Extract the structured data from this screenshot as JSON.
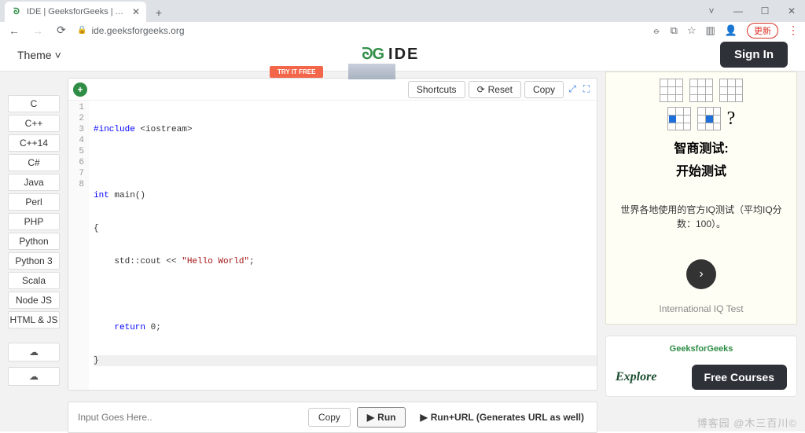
{
  "browser": {
    "tab_title": "IDE | GeeksforGeeks | A comp",
    "favicon_label": "gfg-favicon",
    "url": "ide.geeksforgeeks.org",
    "update_badge": "更新"
  },
  "header": {
    "theme_label": "Theme",
    "logo_mark": "ᘐG",
    "logo_text": "IDE",
    "sign_in": "Sign In"
  },
  "languages": [
    "C",
    "C++",
    "C++14",
    "C#",
    "Java",
    "Perl",
    "PHP",
    "Python",
    "Python 3",
    "Scala",
    "Node JS",
    "HTML & JS"
  ],
  "ad_top": {
    "cta": "TRY IT FREE"
  },
  "editor": {
    "toolbar": {
      "shortcuts": "Shortcuts",
      "reset": "Reset",
      "copy": "Copy"
    },
    "line_count": 8,
    "code": {
      "l1_kw": "#include",
      "l1_rest": " <iostream>",
      "l3_kw": "int",
      "l3_rest": " main()",
      "l4": "{",
      "l5a": "    std::cout << ",
      "l5_str": "\"Hello World\"",
      "l5b": ";",
      "l7_kw": "    return",
      "l7_rest": " 0;",
      "l8": "}"
    }
  },
  "io": {
    "placeholder": "Input Goes Here..",
    "copy": "Copy",
    "run": "Run",
    "run_url": "Run+URL (Generates URL as well)"
  },
  "side_ad": {
    "heading_l1": "智商测试:",
    "heading_l2": "开始测试",
    "body": "世界各地使用的官方IQ测试（平均IQ分数：100）。",
    "footer": "International IQ Test"
  },
  "promo": {
    "brand": "GeeksforGeeks",
    "explore": "Explore",
    "free_courses": "Free Courses"
  },
  "watermark": "博客园 @木三百川©"
}
